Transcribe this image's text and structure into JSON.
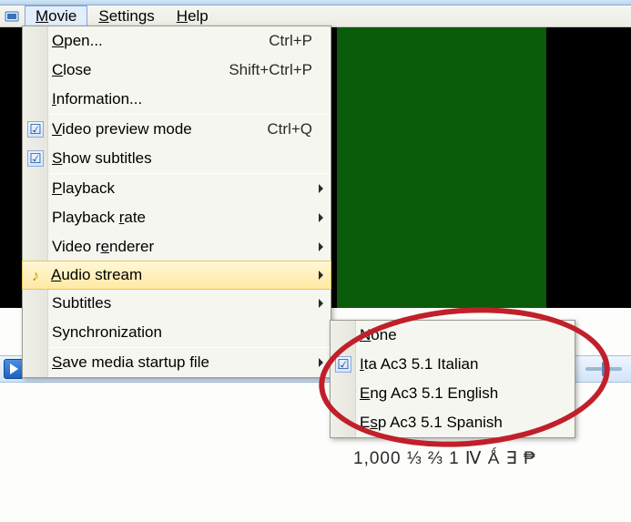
{
  "menubar": {
    "items": [
      {
        "label": "Movie",
        "accel_index": 0
      },
      {
        "label": "Settings",
        "accel_index": 0
      },
      {
        "label": "Help",
        "accel_index": 0
      }
    ],
    "active_index": 0
  },
  "movie_menu": {
    "items": [
      {
        "label": "Open...",
        "accel_index": 0,
        "shortcut": "Ctrl+P"
      },
      {
        "label": "Close",
        "accel_index": 0,
        "shortcut": "Shift+Ctrl+P"
      },
      {
        "label": "Information...",
        "accel_index": 0
      },
      "---",
      {
        "label": "Video preview mode",
        "accel_index": 0,
        "shortcut": "Ctrl+Q",
        "checked": true
      },
      {
        "label": "Show subtitles",
        "accel_index": 0,
        "checked": true
      },
      "---",
      {
        "label": "Playback",
        "accel_index": 0,
        "submenu": true
      },
      {
        "label": "Playback rate",
        "accel_index": 9,
        "submenu": true
      },
      {
        "label": "Video renderer",
        "accel_index": 6,
        "submenu": true
      },
      {
        "label": "Audio stream",
        "accel_index": 0,
        "submenu": true,
        "highlighted": true,
        "icon": "music"
      },
      {
        "label": "Subtitles",
        "accel_index": -1,
        "submenu": true
      },
      {
        "label": "Synchronization",
        "accel_index": -1
      },
      "---",
      {
        "label": "Save media startup file",
        "accel_index": 0,
        "submenu": true
      }
    ]
  },
  "audio_submenu": {
    "items": [
      {
        "label": "None",
        "accel_index": 0
      },
      {
        "label": "Ita Ac3 5.1 Italian",
        "accel_index": 0,
        "checked": true
      },
      {
        "label": "Eng Ac3 5.1 English",
        "accel_index": 0
      },
      {
        "label": "Esp Ac3 5.1 Spanish",
        "accel_index": 1
      }
    ]
  },
  "bottom_text": "1,000  ⅓ ⅔ 1 Ⅳ Ǻ ∃ ₱",
  "annotation": {
    "type": "ellipse",
    "color": "#c0202a"
  }
}
